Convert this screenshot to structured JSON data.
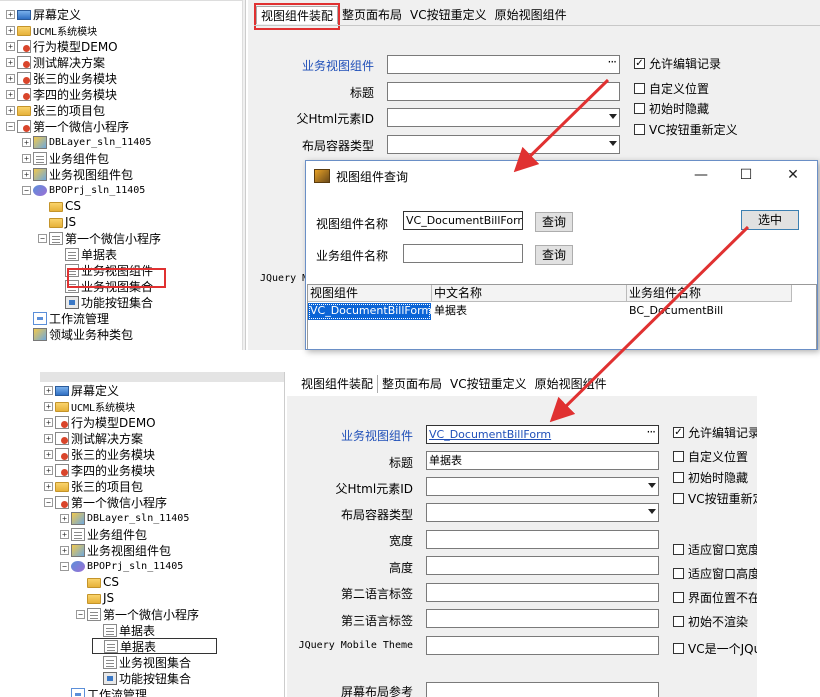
{
  "tree": {
    "items": [
      {
        "label": "屏幕定义",
        "icon": "screen-icon"
      },
      {
        "label": "UCML系统模块",
        "icon": "folder-icon"
      },
      {
        "label": "行为模型DEMO",
        "icon": "person-folder-icon"
      },
      {
        "label": "测试解决方案",
        "icon": "person-folder-icon"
      },
      {
        "label": "张三的业务模块",
        "icon": "person-folder-icon"
      },
      {
        "label": "李四的业务模块",
        "icon": "person-folder-icon"
      },
      {
        "label": "张三的项目包",
        "icon": "folder-icon"
      },
      {
        "label": "第一个微信小程序",
        "icon": "person-folder-icon"
      },
      {
        "label": "DBLayer_sln_11405",
        "icon": "package-icon"
      },
      {
        "label": "业务组件包",
        "icon": "document-icon"
      },
      {
        "label": "业务视图组件包",
        "icon": "package-icon"
      },
      {
        "label": "BPOPrj_sln_11405",
        "icon": "project-icon"
      },
      {
        "label": "CS",
        "icon": "folder-icon"
      },
      {
        "label": "JS",
        "icon": "folder-icon"
      },
      {
        "label": "第一个微信小程序",
        "icon": "grid-icon"
      },
      {
        "label": "单据表",
        "icon": "document-icon"
      },
      {
        "label": "业务视图组件",
        "icon": "document-icon"
      },
      {
        "label": "业务视图集合",
        "icon": "document-icon"
      },
      {
        "label": "功能按钮集合",
        "icon": "button-icon"
      },
      {
        "label": "工作流管理",
        "icon": "workflow-icon"
      },
      {
        "label": "领域业务种类包",
        "icon": "domain-icon"
      }
    ],
    "bottom_items": [
      {
        "label": "屏幕定义"
      },
      {
        "label": "UCML系统模块"
      },
      {
        "label": "行为模型DEMO"
      },
      {
        "label": "测试解决方案"
      },
      {
        "label": "张三的业务模块"
      },
      {
        "label": "李四的业务模块"
      },
      {
        "label": "张三的项目包"
      },
      {
        "label": "第一个微信小程序"
      },
      {
        "label": "DBLayer_sln_11405"
      },
      {
        "label": "业务组件包"
      },
      {
        "label": "业务视图组件包"
      },
      {
        "label": "BPOPrj_sln_11405"
      },
      {
        "label": "CS"
      },
      {
        "label": "JS"
      },
      {
        "label": "第一个微信小程序"
      },
      {
        "label": "单据表"
      },
      {
        "label": "单据表"
      },
      {
        "label": "业务视图集合"
      },
      {
        "label": "功能按钮集合"
      },
      {
        "label": "工作流管理"
      }
    ]
  },
  "tabs": [
    "视图组件装配",
    "整页面布局",
    "VC按钮重定义",
    "原始视图组件"
  ],
  "top_form": {
    "component_label": "业务视图组件",
    "title_label": "标题",
    "parent_html_label": "父Html元素ID",
    "layout_type_label": "布局容器类型",
    "jquery_label_partial": "JQuery M",
    "checkboxes": [
      {
        "label": "允许编辑记录",
        "checked": true
      },
      {
        "label": "自定义位置",
        "checked": false
      },
      {
        "label": "初始时隐藏",
        "checked": false
      },
      {
        "label": "VC按钮重新定义",
        "checked": false
      }
    ]
  },
  "dialog": {
    "title": "视图组件查询",
    "minimize": "—",
    "maximize": "☐",
    "close": "✕",
    "vc_name_label": "视图组件名称",
    "vc_name_value": "VC_DocumentBillForm",
    "bc_name_label": "业务组件名称",
    "bc_name_value": "",
    "query_label": "查询",
    "select_label": "选中",
    "columns": [
      "视图组件",
      "中文名称",
      "业务组件名称"
    ],
    "rows": [
      [
        "VC_DocumentBillForm",
        "单据表",
        "BC_DocumentBill"
      ]
    ]
  },
  "bottom_form": {
    "component_label": "业务视图组件",
    "component_value": "VC_DocumentBillForm",
    "title_label": "标题",
    "title_value": "单据表",
    "parent_html_label": "父Html元素ID",
    "layout_type_label": "布局容器类型",
    "width_label": "宽度",
    "height_label": "高度",
    "lang2_label": "第二语言标签",
    "lang3_label": "第三语言标签",
    "jquery_label": "JQuery Mobile Theme",
    "screen_layout_label": "屏幕布局参考",
    "checkboxes_top": [
      {
        "label": "允许编辑记录",
        "checked": true
      },
      {
        "label": "自定义位置",
        "checked": false
      },
      {
        "label": "初始时隐藏",
        "checked": false
      },
      {
        "label": "VC按钮重新定",
        "checked": false
      }
    ],
    "checkboxes_bottom": [
      {
        "label": "适应窗口宽度",
        "checked": false
      },
      {
        "label": "适应窗口高度",
        "checked": false
      },
      {
        "label": "界面位置不在",
        "checked": false
      },
      {
        "label": "初始不渲染",
        "checked": false
      },
      {
        "label": "VC是一个JQu",
        "checked": false
      }
    ]
  },
  "colors": {
    "highlight_red": "#e03131",
    "label_blue": "#1f4fb8",
    "selection_blue": "#0a64d6"
  }
}
